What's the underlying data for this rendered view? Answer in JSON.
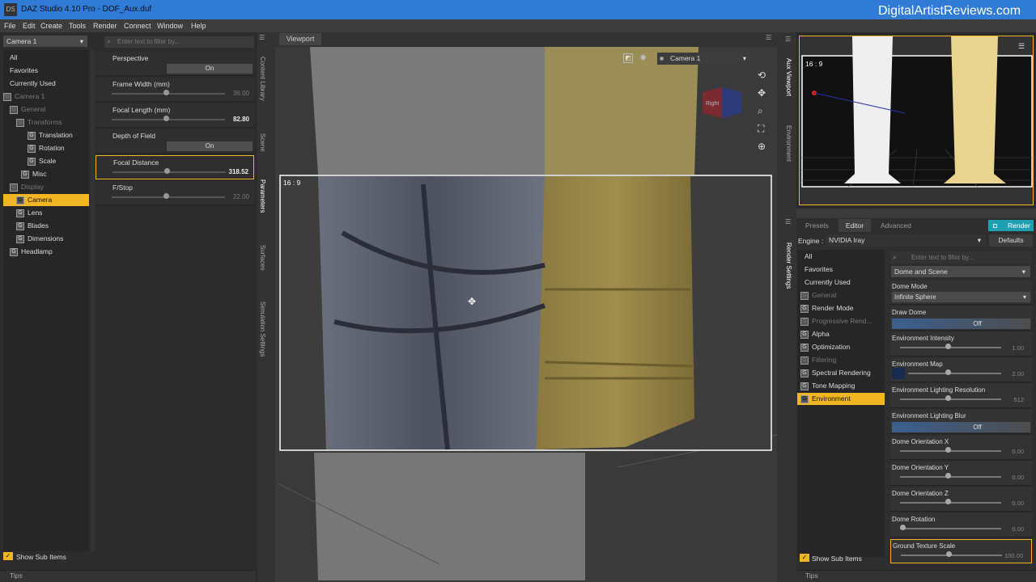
{
  "window": {
    "title": "DAZ Studio 4.10 Pro - DOF_Aux.duf",
    "icon": "DS"
  },
  "watermark": "DigitalArtistReviews.com",
  "menu": [
    "File",
    "Edit",
    "Create",
    "Tools",
    "Render",
    "Connect",
    "Window",
    "Help"
  ],
  "left": {
    "camera_select": "Camera 1",
    "filter_placeholder": "Enter text to filter by...",
    "tree": [
      {
        "label": "All",
        "dim": false,
        "sel": false
      },
      {
        "label": "Favorites",
        "dim": false,
        "sel": false
      },
      {
        "label": "Currently Used",
        "dim": false,
        "sel": false
      },
      {
        "label": "Camera 1",
        "dim": true,
        "sel": false
      },
      {
        "label": "General",
        "dim": true,
        "sel": false
      },
      {
        "label": "Transforms",
        "dim": true,
        "sel": false
      },
      {
        "label": "Translation",
        "dim": false,
        "sel": false
      },
      {
        "label": "Rotation",
        "dim": false,
        "sel": false
      },
      {
        "label": "Scale",
        "dim": false,
        "sel": false
      },
      {
        "label": "Misc",
        "dim": false,
        "sel": false
      },
      {
        "label": "Display",
        "dim": true,
        "sel": false
      },
      {
        "label": "Camera",
        "dim": false,
        "sel": true
      },
      {
        "label": "Lens",
        "dim": false,
        "sel": false
      },
      {
        "label": "Blades",
        "dim": false,
        "sel": false
      },
      {
        "label": "Dimensions",
        "dim": false,
        "sel": false
      },
      {
        "label": "Headlamp",
        "dim": false,
        "sel": false
      }
    ],
    "show_sub_items": "Show Sub Items",
    "tips": "Tips"
  },
  "params": [
    {
      "label": "Perspective",
      "toggle": "On"
    },
    {
      "label": "Frame Width (mm)",
      "value": "36.00",
      "bright": false
    },
    {
      "label": "Focal Length (mm)",
      "value": "82.80",
      "bright": true
    },
    {
      "label": "Depth of Field",
      "toggle": "On"
    },
    {
      "label": "Focal Distance",
      "value": "318.52",
      "bright": true
    },
    {
      "label": "F/Stop",
      "value": "22.00",
      "bright": false
    }
  ],
  "vtabs_left": [
    "Content Library",
    "Scene",
    "Parameters",
    "Surfaces",
    "Simulation Settings"
  ],
  "viewport": {
    "tab": "Viewport",
    "camera": "Camera 1",
    "aspect": "16 : 9",
    "cube": "Right"
  },
  "aux": {
    "aspect": "16 : 9"
  },
  "vtabs_right": [
    "Aux Viewport",
    "Environment"
  ],
  "render": {
    "tabs": [
      "Presets",
      "Editor",
      "Advanced"
    ],
    "render_button": "Render",
    "engine_label": "Engine :",
    "engine": "NVIDIA Iray",
    "defaults": "Defaults",
    "filter_placeholder": "Enter text to filter by...",
    "section": "Dome and Scene",
    "vtab": "Render Settings",
    "tree": [
      {
        "label": "All",
        "dim": false,
        "sel": false
      },
      {
        "label": "Favorites",
        "dim": false,
        "sel": false
      },
      {
        "label": "Currently Used",
        "dim": false,
        "sel": false
      },
      {
        "label": "General",
        "dim": true,
        "sel": false
      },
      {
        "label": "Render Mode",
        "dim": false,
        "sel": false
      },
      {
        "label": "Progressive Rend...",
        "dim": true,
        "sel": false
      },
      {
        "label": "Alpha",
        "dim": false,
        "sel": false
      },
      {
        "label": "Optimization",
        "dim": false,
        "sel": false
      },
      {
        "label": "Filtering",
        "dim": true,
        "sel": false
      },
      {
        "label": "Spectral Rendering",
        "dim": false,
        "sel": false
      },
      {
        "label": "Tone Mapping",
        "dim": false,
        "sel": false
      },
      {
        "label": "Environment",
        "dim": false,
        "sel": true
      }
    ],
    "params": [
      {
        "label": "Dome Mode",
        "select": "Infinite Sphere"
      },
      {
        "label": "Draw Dome",
        "toggle": "Off"
      },
      {
        "label": "Environment Intensity",
        "value": "1.00"
      },
      {
        "label": "Environment Map",
        "value": "2.00"
      },
      {
        "label": "Environment Lighting Resolution",
        "value": "512"
      },
      {
        "label": "Environment Lighting Blur",
        "toggle": "Off"
      },
      {
        "label": "Dome Orientation X",
        "value": "0.00"
      },
      {
        "label": "Dome Orientation Y",
        "value": "0.00"
      },
      {
        "label": "Dome Orientation Z",
        "value": "0.00"
      },
      {
        "label": "Dome Rotation",
        "value": "0.00"
      },
      {
        "label": "Ground Texture Scale",
        "value": "100.00"
      }
    ],
    "show_sub_items": "Show Sub Items",
    "tips": "Tips"
  },
  "colors": {
    "accent": "#f2b624",
    "titlebar": "#2f7bd6",
    "render": "#1f9fb0"
  }
}
